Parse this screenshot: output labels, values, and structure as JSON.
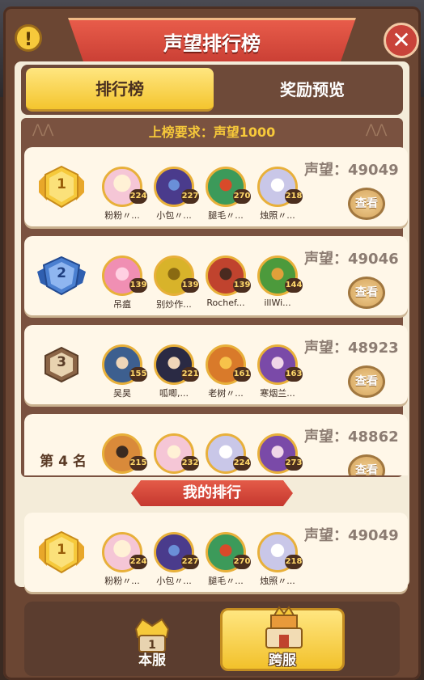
{
  "title": "声望排行榜",
  "info_icon": "!",
  "close_icon": "✕",
  "tabs": [
    {
      "label": "排行榜",
      "active": true
    },
    {
      "label": "奖励预览",
      "active": false
    }
  ],
  "requirement": "上榜要求：声望1000",
  "prestige_prefix": "声望：",
  "view_label": "查看",
  "rows": [
    {
      "rank": "1",
      "prestige": "声望：49049",
      "heroes": [
        {
          "name": "粉粉〃...",
          "level": "224",
          "color": "#f5c6d6"
        },
        {
          "name": "小包〃...",
          "level": "227",
          "color": "#4a3b8c"
        },
        {
          "name": "腿毛〃...",
          "level": "270",
          "color": "#3c9a5a"
        },
        {
          "name": "烛照〃...",
          "level": "218",
          "color": "#c9c7e8"
        }
      ]
    },
    {
      "rank": "2",
      "prestige": "声望：49046",
      "heroes": [
        {
          "name": "吊瘟",
          "level": "139",
          "color": "#f08fb3"
        },
        {
          "name": "别炒作...",
          "level": "139",
          "color": "#d8b32a"
        },
        {
          "name": "Rochef...",
          "level": "139",
          "color": "#c0432e"
        },
        {
          "name": "illWi...",
          "level": "144",
          "color": "#4c9a3c"
        }
      ]
    },
    {
      "rank": "3",
      "prestige": "声望：48923",
      "heroes": [
        {
          "name": "吴昊",
          "level": "155",
          "color": "#3d5f8f"
        },
        {
          "name": "呱唧,...",
          "level": "221",
          "color": "#2a2a44"
        },
        {
          "name": "老树〃...",
          "level": "161",
          "color": "#d97a2a"
        },
        {
          "name": "寒烟兰...",
          "level": "163",
          "color": "#7a4aa8"
        }
      ]
    },
    {
      "rank": "第 4 名",
      "prestige": "声望：48862",
      "heroes": [
        {
          "name": "",
          "level": "215",
          "color": "#d98a3a"
        },
        {
          "name": "",
          "level": "232",
          "color": "#f5c6d6"
        },
        {
          "name": "",
          "level": "224",
          "color": "#c9c7e8"
        },
        {
          "name": "",
          "level": "273",
          "color": "#7a4aa8"
        }
      ]
    }
  ],
  "my_rank_label": "我的排行",
  "my_row": {
    "rank": "1",
    "prestige": "声望：49049",
    "heroes": [
      {
        "name": "粉粉〃...",
        "level": "224",
        "color": "#f5c6d6"
      },
      {
        "name": "小包〃...",
        "level": "227",
        "color": "#4a3b8c"
      },
      {
        "name": "腿毛〃...",
        "level": "270",
        "color": "#3c9a5a"
      },
      {
        "name": "烛照〃...",
        "level": "218",
        "color": "#c9c7e8"
      }
    ]
  },
  "bottom_buttons": [
    {
      "label": "本服",
      "active": false
    },
    {
      "label": "跨服",
      "active": true
    }
  ],
  "colors": {
    "gold": "#f4c52e",
    "silver_blue": "#4a7fd0",
    "bronze": "#8a6446",
    "banner_red": "#d9493b"
  }
}
